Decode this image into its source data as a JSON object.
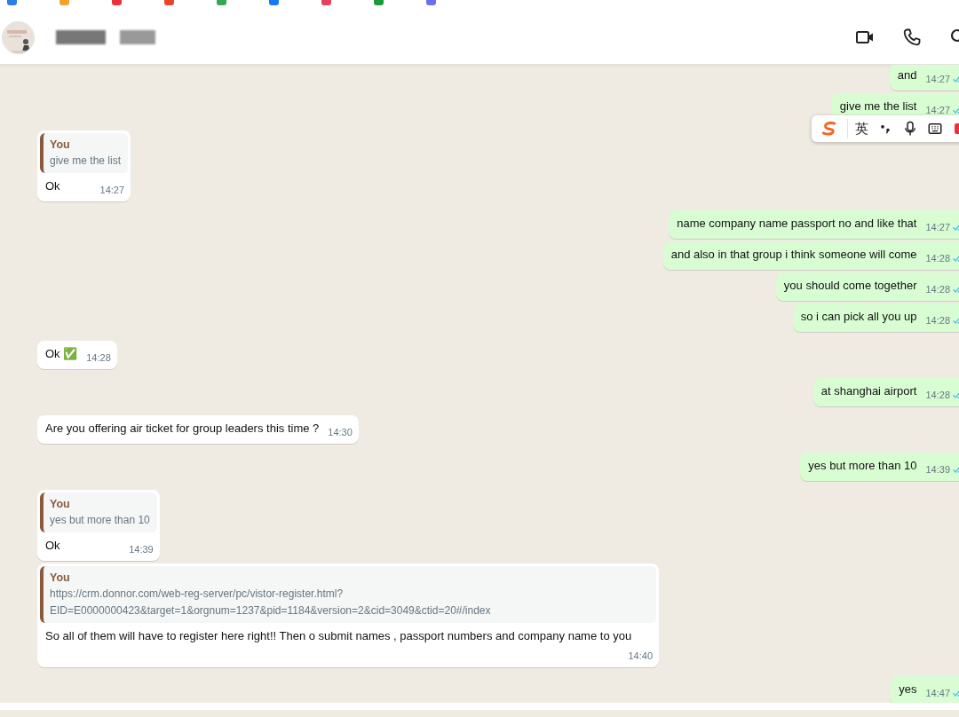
{
  "ime_toolbar": {
    "mode": "英"
  },
  "messages": [
    {
      "kind": "out",
      "text": "and",
      "time": "14:27",
      "read": true
    },
    {
      "kind": "out",
      "text": "give me the list",
      "time": "14:27",
      "read": true
    },
    {
      "kind": "in",
      "quote": {
        "author": "You",
        "text": "give me the list"
      },
      "text": "Ok",
      "time": "14:27"
    },
    {
      "kind": "out",
      "text": "name company name passport no and like that",
      "time": "14:27",
      "read": true
    },
    {
      "kind": "out",
      "text": "and also in that group i think someone will come",
      "time": "14:28",
      "read": true
    },
    {
      "kind": "out",
      "text": "you should come together",
      "time": "14:28",
      "read": true
    },
    {
      "kind": "out",
      "text": "so i can pick all you up",
      "time": "14:28",
      "read": true
    },
    {
      "kind": "in",
      "text": "Ok ✅",
      "time": "14:28"
    },
    {
      "kind": "out",
      "text": "at shanghai airport",
      "time": "14:28",
      "read": true
    },
    {
      "kind": "in",
      "text": "Are you offering air ticket for group leaders this time ?",
      "time": "14:30"
    },
    {
      "kind": "out",
      "text": "yes but more than 10",
      "time": "14:39",
      "read": true
    },
    {
      "kind": "in",
      "quote": {
        "author": "You",
        "text": "yes but more than 10"
      },
      "text": "Ok",
      "time": "14:39"
    },
    {
      "kind": "in",
      "quote": {
        "author": "You",
        "text": "https://crm.donnor.com/web-reg-server/pc/vistor-register.html?\nEID=E0000000423&target=1&orgnum=1237&pid=1184&version=2&cid=3049&ctid=20#/index"
      },
      "text": "So all of them will have to register here right!! Then o submit names , passport numbers and company name to you",
      "time": "14:40"
    },
    {
      "kind": "out",
      "text": "yes",
      "time": "14:47",
      "read": true
    }
  ]
}
